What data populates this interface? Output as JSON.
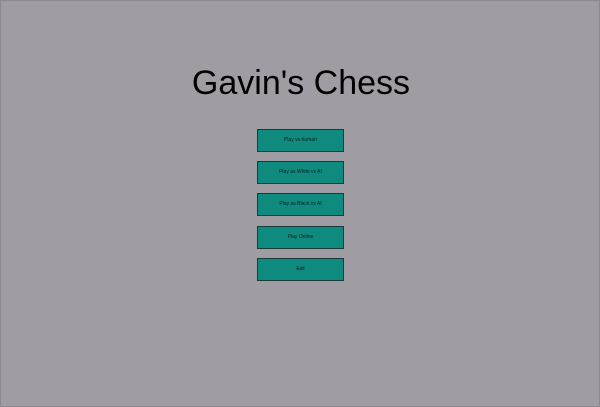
{
  "app": {
    "title": "Gavin's Chess"
  },
  "menu": {
    "buttons": [
      {
        "label": "Play vs human"
      },
      {
        "label": "Play as White vs AI"
      },
      {
        "label": "Play as Black vs AI"
      },
      {
        "label": "Play Online"
      },
      {
        "label": "Exit"
      }
    ]
  },
  "colors": {
    "background": "#9f9ca4",
    "button": "#0e8a7e",
    "button_border": "#1b3b38",
    "title_text": "#000000"
  }
}
